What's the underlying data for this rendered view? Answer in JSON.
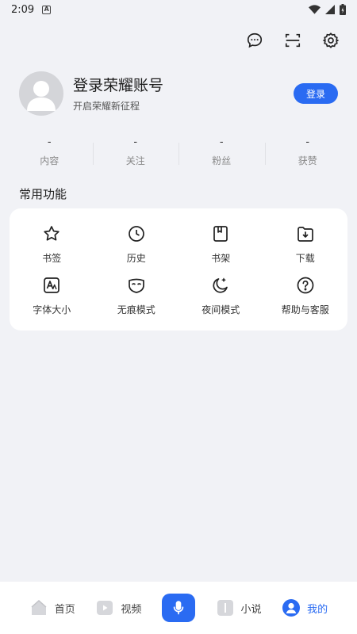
{
  "status_bar": {
    "time": "2:09"
  },
  "profile": {
    "name": "登录荣耀账号",
    "subtitle": "开启荣耀新征程",
    "login_label": "登录"
  },
  "stats": [
    {
      "value": "-",
      "label": "内容"
    },
    {
      "value": "-",
      "label": "关注"
    },
    {
      "value": "-",
      "label": "粉丝"
    },
    {
      "value": "-",
      "label": "获赞"
    }
  ],
  "section": {
    "title": "常用功能"
  },
  "functions": [
    {
      "label": "书签",
      "icon": "star-icon"
    },
    {
      "label": "历史",
      "icon": "clock-icon"
    },
    {
      "label": "书架",
      "icon": "bookshelf-icon"
    },
    {
      "label": "下载",
      "icon": "download-icon"
    },
    {
      "label": "字体大小",
      "icon": "font-size-icon"
    },
    {
      "label": "无痕模式",
      "icon": "mask-icon"
    },
    {
      "label": "夜间模式",
      "icon": "moon-icon"
    },
    {
      "label": "帮助与客服",
      "icon": "help-icon"
    }
  ],
  "nav": {
    "home": "首页",
    "video": "视频",
    "novel": "小说",
    "mine": "我的"
  },
  "colors": {
    "accent": "#2a6bf2",
    "background": "#f1f2f6"
  }
}
